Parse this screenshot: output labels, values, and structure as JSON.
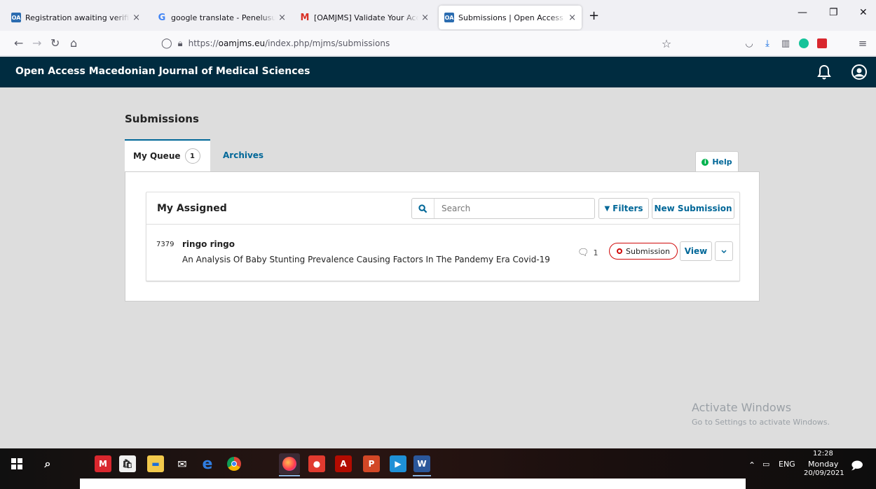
{
  "browser": {
    "tabs": [
      {
        "title": "Registration awaiting verificatio",
        "favicon": "ojs"
      },
      {
        "title": "google translate - Penelusuran",
        "favicon": "google"
      },
      {
        "title": "[OAMJMS] Validate Your Accou",
        "favicon": "gmail"
      },
      {
        "title": "Submissions | Open Access Ma",
        "favicon": "ojs"
      }
    ],
    "new_tab": "+",
    "url_scheme": "https://",
    "url_host": "oamjms.eu",
    "url_path": "/index.php/mjms/submissions"
  },
  "app": {
    "title": "Open Access Macedonian Journal of Medical Sciences"
  },
  "page": {
    "title": "Submissions",
    "tabs": [
      {
        "label": "My Queue",
        "count": "1"
      },
      {
        "label": "Archives"
      }
    ],
    "help_label": "Help"
  },
  "list": {
    "title": "My Assigned",
    "search_placeholder": "Search",
    "filters_label": "Filters",
    "new_submission_label": "New Submission",
    "items": [
      {
        "id": "7379",
        "author": "ringo ringo",
        "title": "An Analysis Of Baby Stunting Prevalence Causing Factors In The Pandemy Era Covid-19",
        "comments": "1",
        "stage": "Submission",
        "view_label": "View"
      }
    ]
  },
  "watermark": {
    "line1": "Activate Windows",
    "line2": "Go to Settings to activate Windows."
  },
  "taskbar": {
    "language": "ENG",
    "time": "12:28",
    "day": "Monday",
    "date": "20/09/2021"
  },
  "colors": {
    "header_bg": "#002c40",
    "link": "#006798",
    "stage_border": "#d00a0a",
    "help_dot": "#00b24e"
  }
}
